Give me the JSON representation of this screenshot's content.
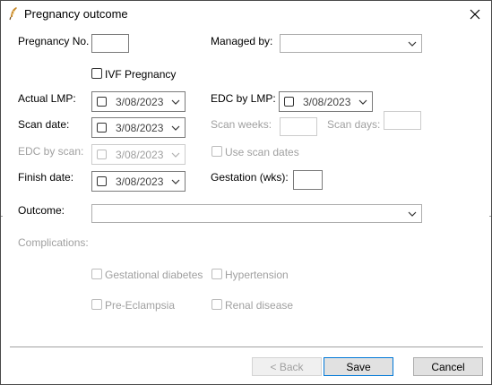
{
  "window": {
    "title": "Pregnancy outcome"
  },
  "labels": {
    "pregnancy_no": "Pregnancy No.",
    "managed_by": "Managed by:",
    "ivf": "IVF Pregnancy",
    "actual_lmp": "Actual LMP:",
    "edc_by_lmp": "EDC by LMP:",
    "scan_date": "Scan date:",
    "scan_weeks": "Scan weeks:",
    "scan_days": "Scan days:",
    "edc_by_scan": "EDC by scan:",
    "use_scan_dates": "Use scan dates",
    "finish_date": "Finish date:",
    "gestation": "Gestation (wks):",
    "outcome": "Outcome:",
    "complications": "Complications:",
    "gestational_diabetes": "Gestational diabetes",
    "hypertension": "Hypertension",
    "pre_eclampsia": "Pre-Eclampsia",
    "renal_disease": "Renal disease"
  },
  "values": {
    "pregnancy_no": "",
    "managed_by": "",
    "actual_lmp": "3/08/2023",
    "edc_by_lmp": "3/08/2023",
    "scan_date": "3/08/2023",
    "edc_by_scan": "3/08/2023",
    "finish_date": "3/08/2023",
    "scan_weeks": "",
    "scan_days": "",
    "gestation": "",
    "outcome": ""
  },
  "buttons": {
    "back": "< Back",
    "save": "Save",
    "cancel": "Cancel"
  },
  "colors": {
    "focus_border": "#0078d7",
    "disabled_text": "#a0a0a0"
  },
  "icons": {
    "title": "app-feather-icon",
    "close": "close-icon",
    "dropdown": "chevron-down-icon"
  }
}
